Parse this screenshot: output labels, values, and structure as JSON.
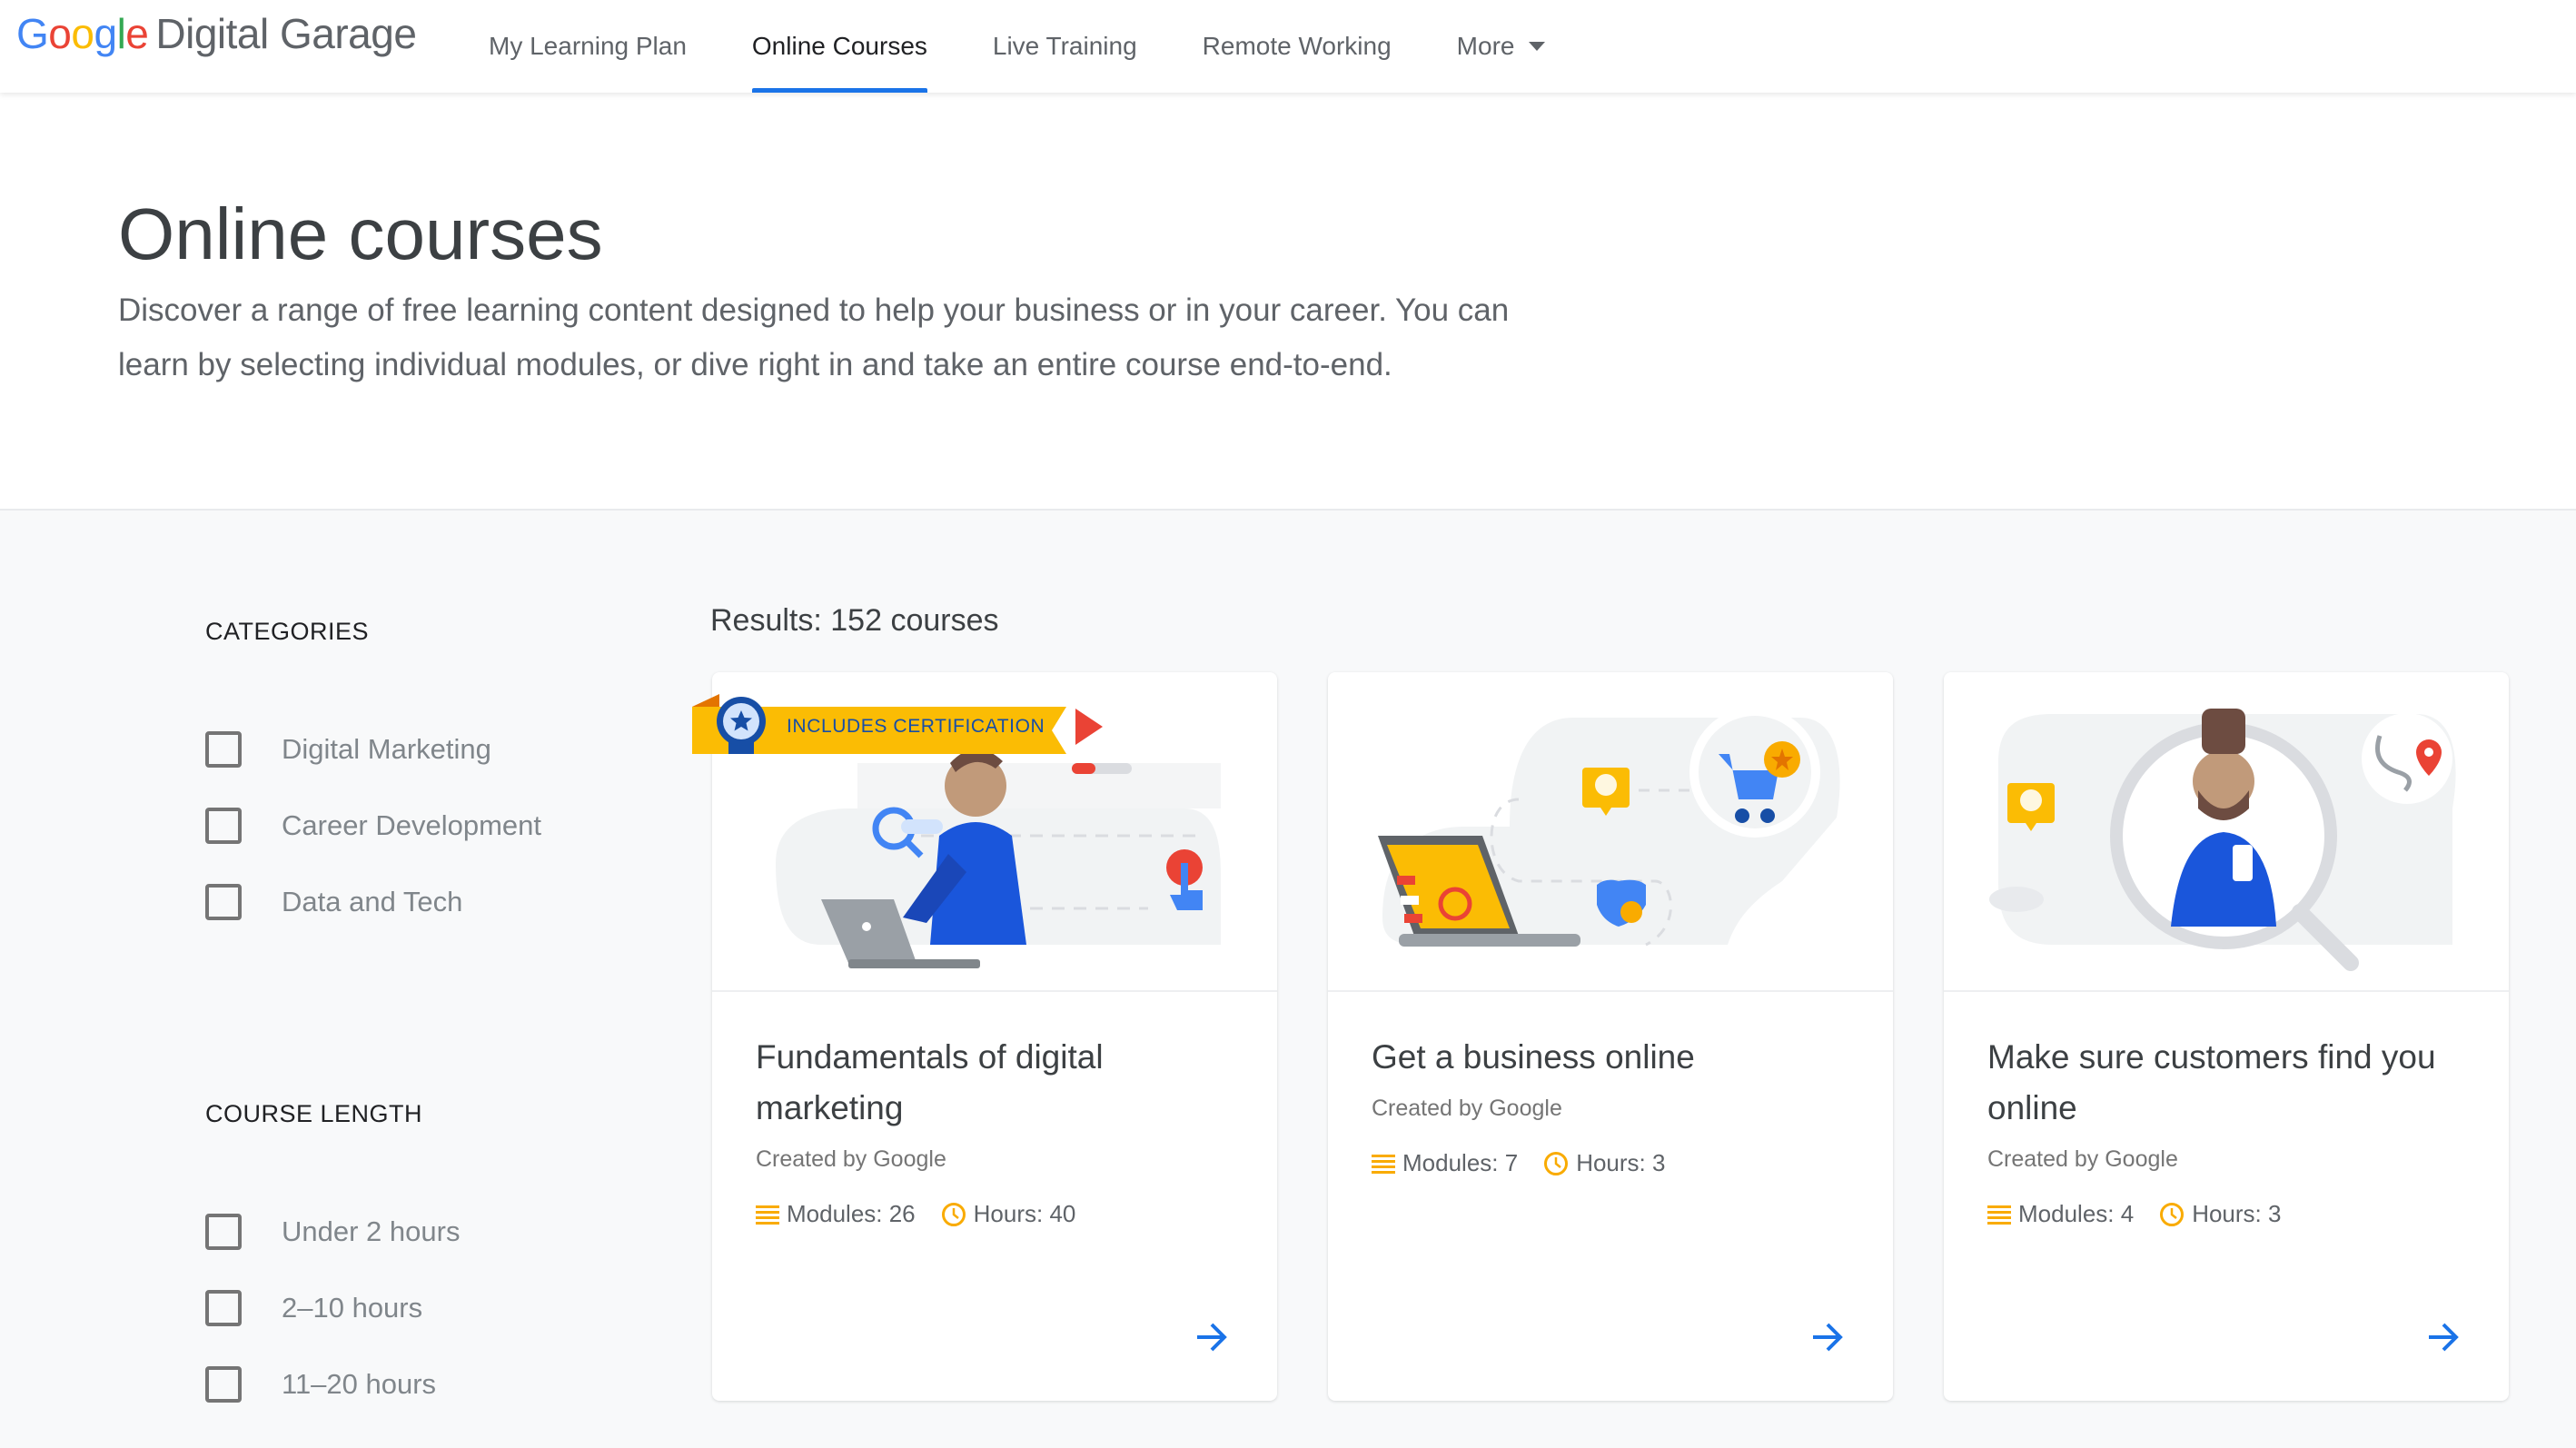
{
  "header": {
    "logo": {
      "google": [
        "G",
        "o",
        "o",
        "g",
        "l",
        "e"
      ],
      "google_colors": [
        "#4285f4",
        "#ea4335",
        "#fbbc04",
        "#4285f4",
        "#34a853",
        "#ea4335"
      ],
      "brand": "Digital Garage"
    },
    "nav": [
      {
        "label": "My Learning Plan",
        "active": false
      },
      {
        "label": "Online Courses",
        "active": true
      },
      {
        "label": "Live Training",
        "active": false
      },
      {
        "label": "Remote Working",
        "active": false
      },
      {
        "label": "More",
        "active": false,
        "icon": "caret-down-icon"
      }
    ]
  },
  "hero": {
    "title": "Online courses",
    "description": "Discover a range of free learning content designed to help your business or in your career. You can learn by selecting individual modules, or dive right in and take an entire course end-to-end."
  },
  "filters": {
    "categories": {
      "heading": "CATEGORIES",
      "options": [
        "Digital Marketing",
        "Career Development",
        "Data and Tech"
      ]
    },
    "course_length": {
      "heading": "COURSE LENGTH",
      "options": [
        "Under 2 hours",
        "2–10 hours",
        "11–20 hours"
      ]
    }
  },
  "results": {
    "label": "Results: 152 courses"
  },
  "colors": {
    "accent": "#1a73e8",
    "meta_icon": "#f9ab00",
    "ribbon": "#fbbc04",
    "ribbon_text": "#174ea6"
  },
  "courses": [
    {
      "title": "Fundamentals of digital marketing",
      "author": "Created by Google",
      "modules": "Modules: 26",
      "hours": "Hours: 40",
      "badge": "INCLUDES CERTIFICATION"
    },
    {
      "title": "Get a business online",
      "author": "Created by Google",
      "modules": "Modules: 7",
      "hours": "Hours: 3"
    },
    {
      "title": "Make sure customers find you online",
      "author": "Created by Google",
      "modules": "Modules: 4",
      "hours": "Hours: 3"
    }
  ]
}
